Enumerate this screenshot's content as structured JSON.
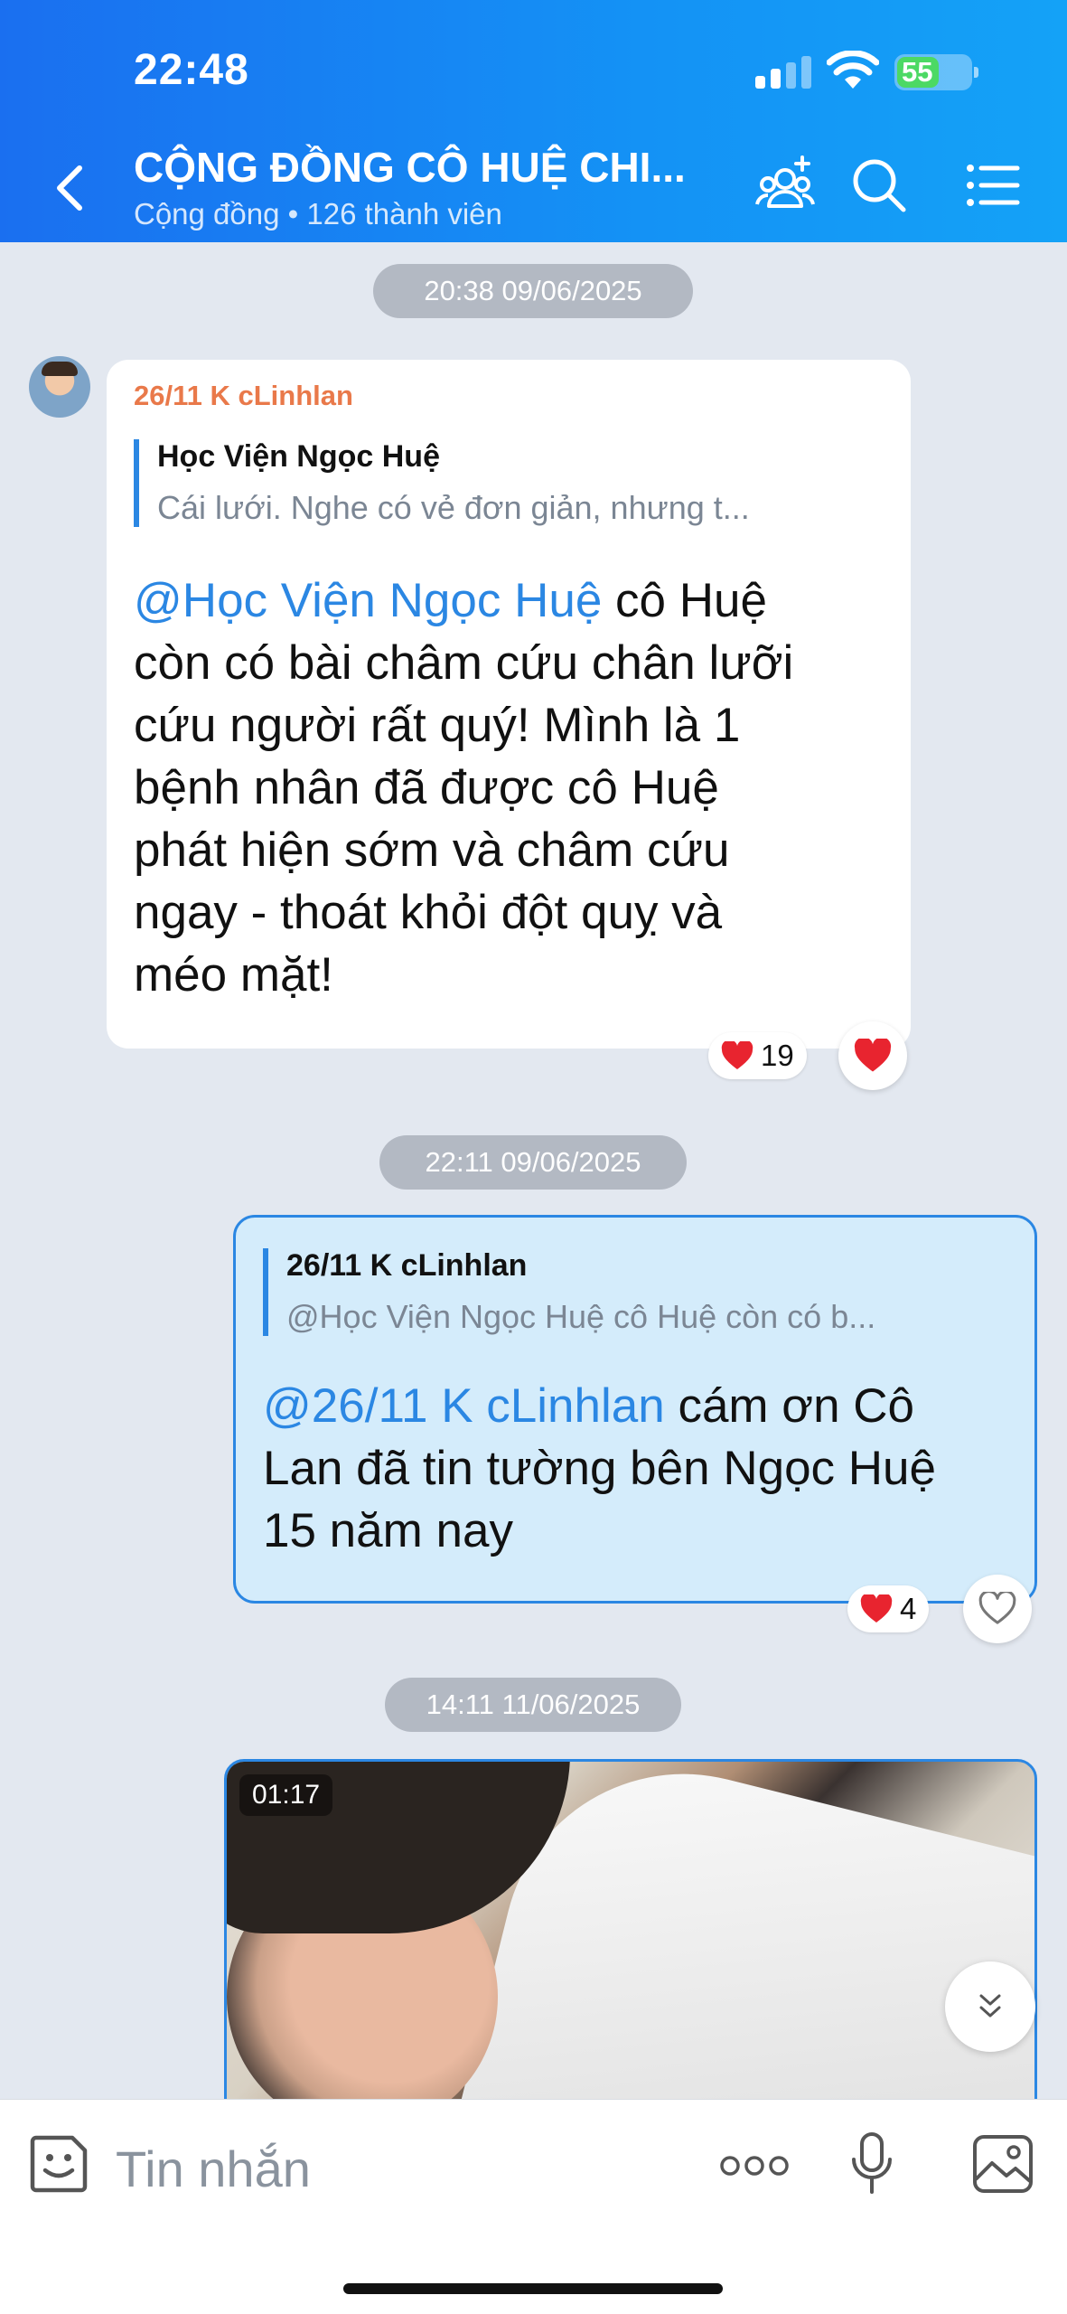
{
  "status_bar": {
    "time": "22:48",
    "battery": "55"
  },
  "header": {
    "title": "CỘNG ĐỒNG CÔ HUỆ CHI...",
    "subtitle": "Cộng đồng • 126 thành viên",
    "accent": "#1a6ff0"
  },
  "messages": [
    {
      "timestamp": "20:38 09/06/2025",
      "sender": "26/11 K cLinhlan",
      "quote_name": "Học Viện Ngọc Huệ",
      "quote_text": "Cái lưới. Nghe có vẻ đơn giản, nhưng t...",
      "mention": "@Học Viện Ngọc Huệ",
      "text_lines": [
        " cô Huệ",
        "còn có bài châm cứu chân lưỡi",
        "cứu người rất quý! Mình là 1",
        "bệnh nhân đã được cô Huệ",
        "phát hiện sớm và châm cứu",
        "ngay - thoát khỏi đột quỵ và",
        "méo mặt!"
      ],
      "reaction_count": "19"
    },
    {
      "timestamp": "22:11 09/06/2025",
      "quote_name": "26/11 K cLinhlan",
      "quote_text": "@Học Viện Ngọc Huệ cô Huệ còn có b...",
      "mention": "@26/11 K cLinhlan",
      "text_lines": [
        " cám ơn Cô",
        "Lan đã tin tường bên Ngọc Huệ",
        "15 năm nay"
      ],
      "reaction_count": "4"
    },
    {
      "timestamp": "14:11 11/06/2025",
      "video_duration": "01:17"
    }
  ],
  "composer": {
    "placeholder": "Tin nhắn"
  },
  "icons": {
    "back": "chevron-left-icon",
    "add_member": "add-member-icon",
    "search": "search-icon",
    "menu": "list-icon",
    "sticker": "sticker-icon",
    "more": "more-dots-icon",
    "mic": "microphone-icon",
    "image": "image-icon"
  }
}
